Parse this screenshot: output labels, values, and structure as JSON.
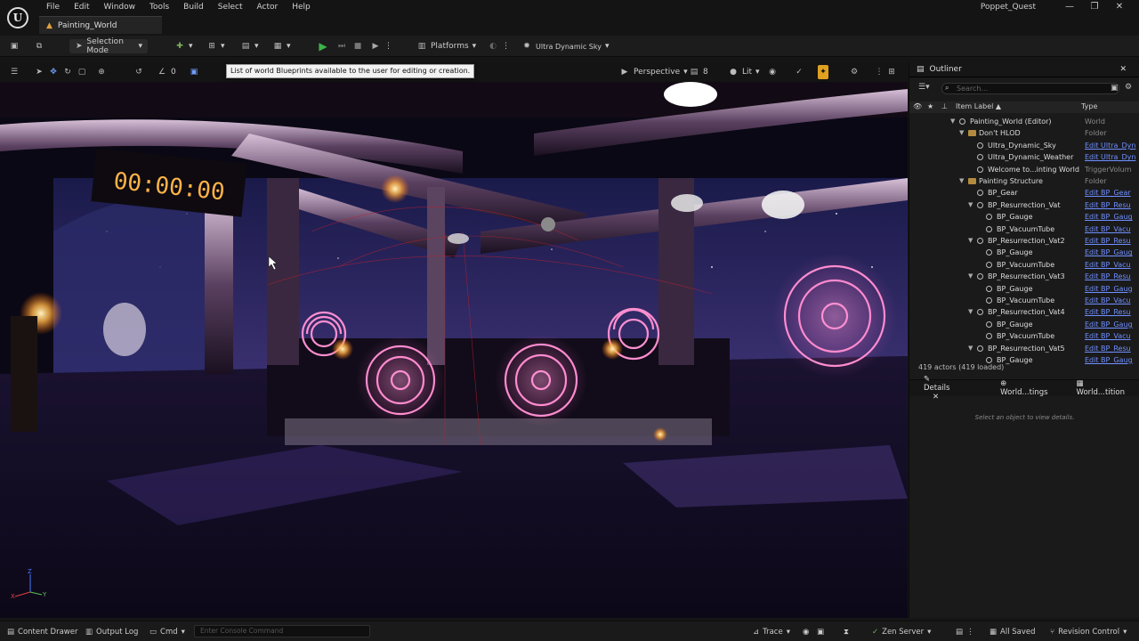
{
  "app": {
    "logo": "U",
    "project_name": "Poppet_Quest",
    "document_tab": "Painting_World"
  },
  "menu": [
    "File",
    "Edit",
    "Window",
    "Tools",
    "Build",
    "Select",
    "Actor",
    "Help"
  ],
  "window_controls": [
    "—",
    "❐",
    "✕"
  ],
  "toolbar": {
    "selection_mode": "Selection Mode",
    "platforms": "Platforms",
    "sky": "Ultra Dynamic Sky"
  },
  "viewport": {
    "perspective": "Perspective",
    "lit": "Lit",
    "speed": "8",
    "snap_deg": "0",
    "tooltip": "List of world Blueprints available to the user for editing or creation.",
    "clock_text": "00:00:00",
    "axis": {
      "z": "Z",
      "x": "X",
      "y": "Y"
    }
  },
  "outliner": {
    "title": "Outliner",
    "search_placeholder": "Search...",
    "col_label": "Item Label ▲",
    "col_type": "Type",
    "rows": [
      {
        "label": "Painting_World (Editor)",
        "type": "World",
        "indent": 0,
        "kind": "world",
        "plain": true
      },
      {
        "label": "Don't HLOD",
        "type": "Folder",
        "indent": 1,
        "kind": "folder",
        "plain": true
      },
      {
        "label": "Ultra_Dynamic_Sky",
        "type": "Edit Ultra_Dyn",
        "indent": 2,
        "kind": "actor"
      },
      {
        "label": "Ultra_Dynamic_Weather",
        "type": "Edit Ultra_Dyn",
        "indent": 2,
        "kind": "actor"
      },
      {
        "label": "Welcome to...inting World",
        "type": "TriggerVolum",
        "indent": 2,
        "kind": "actor",
        "plain": true
      },
      {
        "label": "Painting Structure",
        "type": "Folder",
        "indent": 1,
        "kind": "folder",
        "plain": true
      },
      {
        "label": "BP_Gear",
        "type": "Edit BP_Gear",
        "indent": 2,
        "kind": "actor"
      },
      {
        "label": "BP_Resurrection_Vat",
        "type": "Edit BP_Resu",
        "indent": 2,
        "kind": "actor",
        "open": true
      },
      {
        "label": "BP_Gauge",
        "type": "Edit BP_Gaug",
        "indent": 3,
        "kind": "actor"
      },
      {
        "label": "BP_VacuumTube",
        "type": "Edit BP_Vacu",
        "indent": 3,
        "kind": "actor"
      },
      {
        "label": "BP_Resurrection_Vat2",
        "type": "Edit BP_Resu",
        "indent": 2,
        "kind": "actor",
        "open": true
      },
      {
        "label": "BP_Gauge",
        "type": "Edit BP_Gaug",
        "indent": 3,
        "kind": "actor"
      },
      {
        "label": "BP_VacuumTube",
        "type": "Edit BP_Vacu",
        "indent": 3,
        "kind": "actor"
      },
      {
        "label": "BP_Resurrection_Vat3",
        "type": "Edit BP_Resu",
        "indent": 2,
        "kind": "actor",
        "open": true
      },
      {
        "label": "BP_Gauge",
        "type": "Edit BP_Gaug",
        "indent": 3,
        "kind": "actor"
      },
      {
        "label": "BP_VacuumTube",
        "type": "Edit BP_Vacu",
        "indent": 3,
        "kind": "actor"
      },
      {
        "label": "BP_Resurrection_Vat4",
        "type": "Edit BP_Resu",
        "indent": 2,
        "kind": "actor",
        "open": true
      },
      {
        "label": "BP_Gauge",
        "type": "Edit BP_Gaug",
        "indent": 3,
        "kind": "actor"
      },
      {
        "label": "BP_VacuumTube",
        "type": "Edit BP_Vacu",
        "indent": 3,
        "kind": "actor"
      },
      {
        "label": "BP_Resurrection_Vat5",
        "type": "Edit BP_Resu",
        "indent": 2,
        "kind": "actor",
        "open": true
      },
      {
        "label": "BP_Gauge",
        "type": "Edit BP_Gaug",
        "indent": 3,
        "kind": "actor"
      }
    ],
    "actor_count": "419 actors (419 loaded)"
  },
  "details": {
    "tabs": [
      "Details",
      "World...tings",
      "World...tition"
    ],
    "empty_message": "Select an object to view details."
  },
  "statusbar": {
    "content_drawer": "Content Drawer",
    "output_log": "Output Log",
    "cmd": "Cmd",
    "console_placeholder": "Enter Console Command",
    "trace": "Trace",
    "zen_server": "Zen Server",
    "all_saved": "All Saved",
    "revision_control": "Revision Control"
  },
  "colors": {
    "accent_play": "#3cb34a",
    "link": "#6f8fff",
    "glyph_pink": "#ff8fd0",
    "lamp": "#ffb347"
  }
}
